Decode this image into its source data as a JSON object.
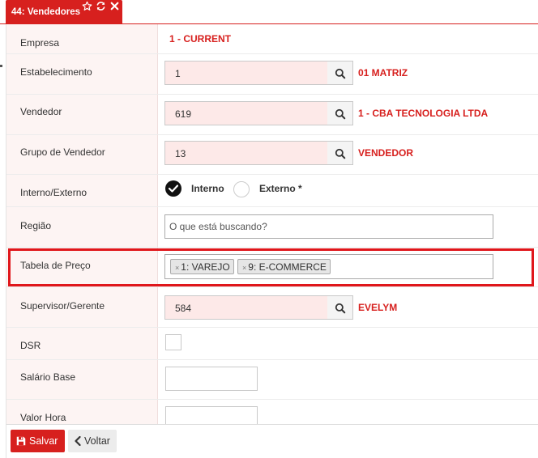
{
  "tab": {
    "title": "44: Vendedores",
    "icons": [
      "star-outline-icon",
      "refresh-icon",
      "close-icon"
    ]
  },
  "colors": {
    "accent": "#d7201e",
    "required_field_bg": "#fde9e8",
    "label_column_bg": "#fdf4f3"
  },
  "form": {
    "empresa": {
      "label": "Empresa",
      "value": "1 - CURRENT"
    },
    "estabelecimento": {
      "label": "Estabelecimento",
      "value": "1",
      "description": "01 MATRIZ"
    },
    "vendedor": {
      "label": "Vendedor",
      "value": "619",
      "description": "1 - CBA TECNOLOGIA LTDA"
    },
    "grupo_vendedor": {
      "label": "Grupo de Vendedor",
      "value": "13",
      "description": "VENDEDOR"
    },
    "interno_externo": {
      "label": "Interno/Externo",
      "options": [
        {
          "label": "Interno",
          "selected": true
        },
        {
          "label": "Externo *",
          "selected": false
        }
      ]
    },
    "regiao": {
      "label": "Região",
      "placeholder": "O que está buscando?"
    },
    "tabela_preco": {
      "label": "Tabela de Preço",
      "tags": [
        {
          "remove": "×",
          "text": "1: VAREJO"
        },
        {
          "remove": "×",
          "text": "9: E-COMMERCE"
        }
      ]
    },
    "supervisor": {
      "label": "Supervisor/Gerente",
      "value": "584",
      "description": "EVELYM"
    },
    "dsr": {
      "label": "DSR",
      "checked": false
    },
    "salario_base": {
      "label": "Salário Base",
      "value": ""
    },
    "valor_hora": {
      "label": "Valor Hora",
      "value": ""
    }
  },
  "footer": {
    "save_label": "Salvar",
    "back_label": "Voltar"
  }
}
